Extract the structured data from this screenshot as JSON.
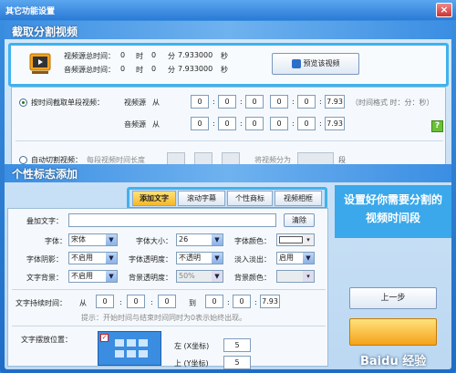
{
  "window": {
    "title": "其它功能设置",
    "close": "×"
  },
  "clip": {
    "section_title": "截取分割视频",
    "video_total_label": "视频源总时间：",
    "video_total": {
      "h": "0",
      "m": "0",
      "s": "7.933000"
    },
    "audio_total_label": "音频源总时间：",
    "audio_total": {
      "h": "0",
      "m": "0",
      "s": "7.933000"
    },
    "units": {
      "h": "时",
      "m": "分",
      "s": "秒"
    },
    "preview_button": "预览该视频",
    "by_time_label": "按时间截取单段视频：",
    "video_src": "视频源",
    "audio_src": "音频源",
    "from": "从",
    "to": "到",
    "colon": ":",
    "video_from": [
      "0",
      "0",
      "0"
    ],
    "video_to": [
      "0",
      "0",
      "7.93"
    ],
    "audio_from": [
      "0",
      "0",
      "0"
    ],
    "audio_to": [
      "0",
      "0",
      "7.93"
    ],
    "time_format_hint": "（时间格式  时：分：秒）",
    "auto_cut_label": "自动切割视频：",
    "segment_len_label": "每段视频时间长度",
    "split_into_label": "将视频分为",
    "segment_unit": "段"
  },
  "logo": {
    "section_title": "个性标志添加",
    "tabs": [
      "添加文字",
      "滚动字幕",
      "个性商标",
      "视频相框"
    ],
    "add_text_label": "叠加文字：",
    "clear_button": "清除",
    "font_label": "字体：",
    "font_value": "宋体",
    "font_size_label": "字体大小：",
    "font_size_value": "26",
    "font_color_label": "字体颜色：",
    "shadow_label": "字体阴影：",
    "shadow_value": "不启用",
    "opacity_label": "字体透明度：",
    "opacity_value": "不透明",
    "fade_label": "淡入淡出：",
    "fade_value": "启用",
    "bg_label": "文字背景：",
    "bg_value": "不启用",
    "bg_opacity_label": "背景透明度：",
    "bg_opacity_value": "50%",
    "bg_color_label": "背景颜色：",
    "duration_label": "文字持续时间：",
    "from": "从",
    "to": "到",
    "colon": ":",
    "dur_from": [
      "0",
      "0",
      "0"
    ],
    "dur_to": [
      "0",
      "0",
      "7.93"
    ],
    "hint": "提示：开始时间与结束时间同时为0表示始终出现。",
    "position_label": "文字摆放位置：",
    "left_label": "左 (X坐标)",
    "left_value": "5",
    "top_label": "上 (Y坐标)",
    "top_value": "5"
  },
  "callout": "设置好你需要分割的视频时间段",
  "prev_button": "上一步",
  "watermark": "Baidu 经验"
}
